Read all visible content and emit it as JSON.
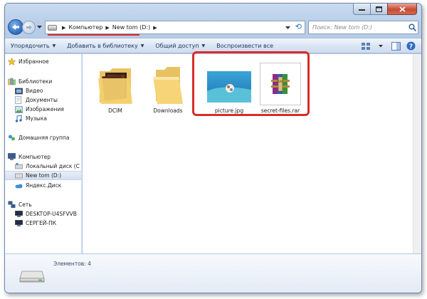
{
  "address": {
    "crumbs": [
      "Компьютер",
      "New tom (D:)"
    ]
  },
  "search": {
    "placeholder": "Поиск: New tom (D:)"
  },
  "toolbar": {
    "organize": "Упорядочить",
    "add_library": "Добавить в библиотеку",
    "share": "Общий доступ",
    "play_all": "Воспроизвести все"
  },
  "sidebar": {
    "favorites": "Избранное",
    "libraries": "Библиотеки",
    "video": "Видео",
    "documents": "Документы",
    "images": "Изображения",
    "music": "Музыка",
    "homegroup": "Домашняя группа",
    "computer": "Компьютер",
    "local_disk": "Локальный диск (C",
    "new_tom": "New tom (D:)",
    "yandex_disk": "Яндекс.Диск",
    "network": "Сеть",
    "desktop": "DESKTOP-U4SFVVB",
    "pc_sergey": "СЕРГЕЙ-ПК"
  },
  "files": [
    {
      "name": "DCIM",
      "icon": "folder-photos-icon"
    },
    {
      "name": "Downloads",
      "icon": "folder-icon"
    },
    {
      "name": "picture.jpg",
      "icon": "image-thumbnail"
    },
    {
      "name": "secret-files.rar",
      "icon": "winrar-archive-icon"
    }
  ],
  "details": {
    "count_label": "Элементов: 4"
  },
  "colors": {
    "highlight": "#d92b2b",
    "toolbar_text": "#1e395b"
  }
}
